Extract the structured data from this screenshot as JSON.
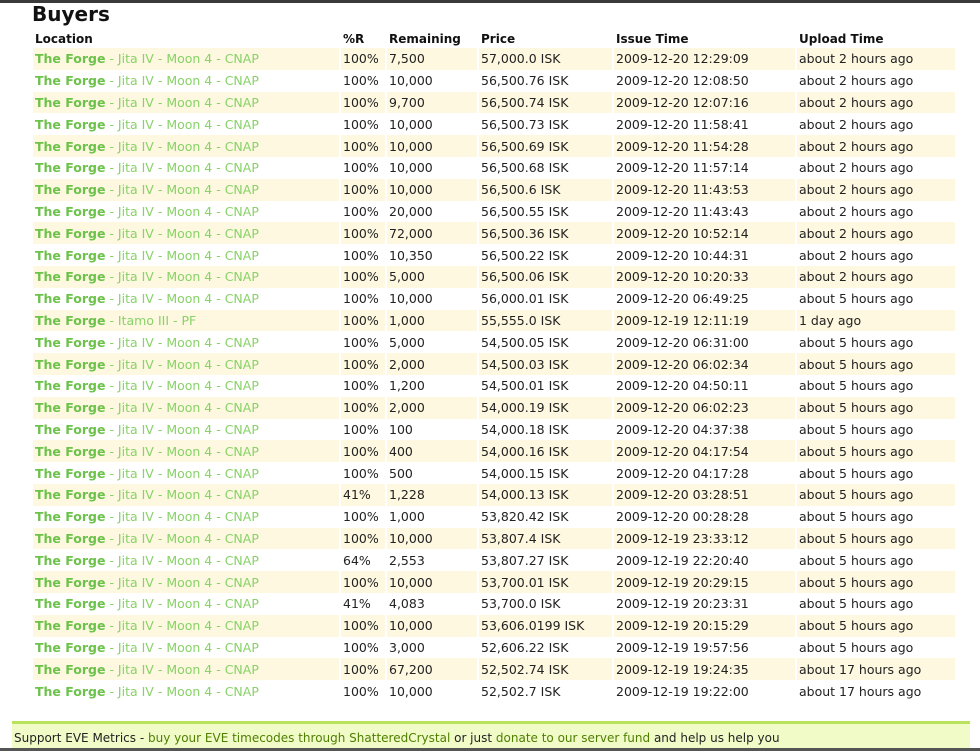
{
  "title": "Buyers",
  "columns": [
    "Location",
    "%R",
    "Remaining",
    "Price",
    "Issue Time",
    "Upload Time"
  ],
  "rows": [
    [
      "The Forge",
      " - Jita IV - Moon 4 - CNAP",
      "100%",
      "7,500",
      "57,000.0 ISK",
      "2009-12-20 12:29:09",
      "about 2 hours ago"
    ],
    [
      "The Forge",
      " - Jita IV - Moon 4 - CNAP",
      "100%",
      "10,000",
      "56,500.76 ISK",
      "2009-12-20 12:08:50",
      "about 2 hours ago"
    ],
    [
      "The Forge",
      " - Jita IV - Moon 4 - CNAP",
      "100%",
      "9,700",
      "56,500.74 ISK",
      "2009-12-20 12:07:16",
      "about 2 hours ago"
    ],
    [
      "The Forge",
      " - Jita IV - Moon 4 - CNAP",
      "100%",
      "10,000",
      "56,500.73 ISK",
      "2009-12-20 11:58:41",
      "about 2 hours ago"
    ],
    [
      "The Forge",
      " - Jita IV - Moon 4 - CNAP",
      "100%",
      "10,000",
      "56,500.69 ISK",
      "2009-12-20 11:54:28",
      "about 2 hours ago"
    ],
    [
      "The Forge",
      " - Jita IV - Moon 4 - CNAP",
      "100%",
      "10,000",
      "56,500.68 ISK",
      "2009-12-20 11:57:14",
      "about 2 hours ago"
    ],
    [
      "The Forge",
      " - Jita IV - Moon 4 - CNAP",
      "100%",
      "10,000",
      "56,500.6 ISK",
      "2009-12-20 11:43:53",
      "about 2 hours ago"
    ],
    [
      "The Forge",
      " - Jita IV - Moon 4 - CNAP",
      "100%",
      "20,000",
      "56,500.55 ISK",
      "2009-12-20 11:43:43",
      "about 2 hours ago"
    ],
    [
      "The Forge",
      " - Jita IV - Moon 4 - CNAP",
      "100%",
      "72,000",
      "56,500.36 ISK",
      "2009-12-20 10:52:14",
      "about 2 hours ago"
    ],
    [
      "The Forge",
      " - Jita IV - Moon 4 - CNAP",
      "100%",
      "10,350",
      "56,500.22 ISK",
      "2009-12-20 10:44:31",
      "about 2 hours ago"
    ],
    [
      "The Forge",
      " - Jita IV - Moon 4 - CNAP",
      "100%",
      "5,000",
      "56,500.06 ISK",
      "2009-12-20 10:20:33",
      "about 2 hours ago"
    ],
    [
      "The Forge",
      " - Jita IV - Moon 4 - CNAP",
      "100%",
      "10,000",
      "56,000.01 ISK",
      "2009-12-20 06:49:25",
      "about 5 hours ago"
    ],
    [
      "The Forge",
      " - Itamo III - PF",
      "100%",
      "1,000",
      "55,555.0 ISK",
      "2009-12-19 12:11:19",
      "1 day ago"
    ],
    [
      "The Forge",
      " - Jita IV - Moon 4 - CNAP",
      "100%",
      "5,000",
      "54,500.05 ISK",
      "2009-12-20 06:31:00",
      "about 5 hours ago"
    ],
    [
      "The Forge",
      " - Jita IV - Moon 4 - CNAP",
      "100%",
      "2,000",
      "54,500.03 ISK",
      "2009-12-20 06:02:34",
      "about 5 hours ago"
    ],
    [
      "The Forge",
      " - Jita IV - Moon 4 - CNAP",
      "100%",
      "1,200",
      "54,500.01 ISK",
      "2009-12-20 04:50:11",
      "about 5 hours ago"
    ],
    [
      "The Forge",
      " - Jita IV - Moon 4 - CNAP",
      "100%",
      "2,000",
      "54,000.19 ISK",
      "2009-12-20 06:02:23",
      "about 5 hours ago"
    ],
    [
      "The Forge",
      " - Jita IV - Moon 4 - CNAP",
      "100%",
      "100",
      "54,000.18 ISK",
      "2009-12-20 04:37:38",
      "about 5 hours ago"
    ],
    [
      "The Forge",
      " - Jita IV - Moon 4 - CNAP",
      "100%",
      "400",
      "54,000.16 ISK",
      "2009-12-20 04:17:54",
      "about 5 hours ago"
    ],
    [
      "The Forge",
      " - Jita IV - Moon 4 - CNAP",
      "100%",
      "500",
      "54,000.15 ISK",
      "2009-12-20 04:17:28",
      "about 5 hours ago"
    ],
    [
      "The Forge",
      " - Jita IV - Moon 4 - CNAP",
      "41%",
      "1,228",
      "54,000.13 ISK",
      "2009-12-20 03:28:51",
      "about 5 hours ago"
    ],
    [
      "The Forge",
      " - Jita IV - Moon 4 - CNAP",
      "100%",
      "1,000",
      "53,820.42 ISK",
      "2009-12-20 00:28:28",
      "about 5 hours ago"
    ],
    [
      "The Forge",
      " - Jita IV - Moon 4 - CNAP",
      "100%",
      "10,000",
      "53,807.4 ISK",
      "2009-12-19 23:33:12",
      "about 5 hours ago"
    ],
    [
      "The Forge",
      " - Jita IV - Moon 4 - CNAP",
      "64%",
      "2,553",
      "53,807.27 ISK",
      "2009-12-19 22:20:40",
      "about 5 hours ago"
    ],
    [
      "The Forge",
      " - Jita IV - Moon 4 - CNAP",
      "100%",
      "10,000",
      "53,700.01 ISK",
      "2009-12-19 20:29:15",
      "about 5 hours ago"
    ],
    [
      "The Forge",
      " - Jita IV - Moon 4 - CNAP",
      "41%",
      "4,083",
      "53,700.0 ISK",
      "2009-12-19 20:23:31",
      "about 5 hours ago"
    ],
    [
      "The Forge",
      " - Jita IV - Moon 4 - CNAP",
      "100%",
      "10,000",
      "53,606.0199 ISK",
      "2009-12-19 20:15:29",
      "about 5 hours ago"
    ],
    [
      "The Forge",
      " - Jita IV - Moon 4 - CNAP",
      "100%",
      "3,000",
      "52,606.22 ISK",
      "2009-12-19 19:57:56",
      "about 5 hours ago"
    ],
    [
      "The Forge",
      " - Jita IV - Moon 4 - CNAP",
      "100%",
      "67,200",
      "52,502.74 ISK",
      "2009-12-19 19:24:35",
      "about 17 hours ago"
    ],
    [
      "The Forge",
      " - Jita IV - Moon 4 - CNAP",
      "100%",
      "10,000",
      "52,502.7 ISK",
      "2009-12-19 19:22:00",
      "about 17 hours ago"
    ]
  ],
  "footer": {
    "prefix": "Support EVE Metrics - ",
    "link1": "buy your EVE timecodes through ShatteredCrystal",
    "mid": " or just ",
    "link2": "donate to our server fund",
    "suffix": " and help us help you"
  }
}
